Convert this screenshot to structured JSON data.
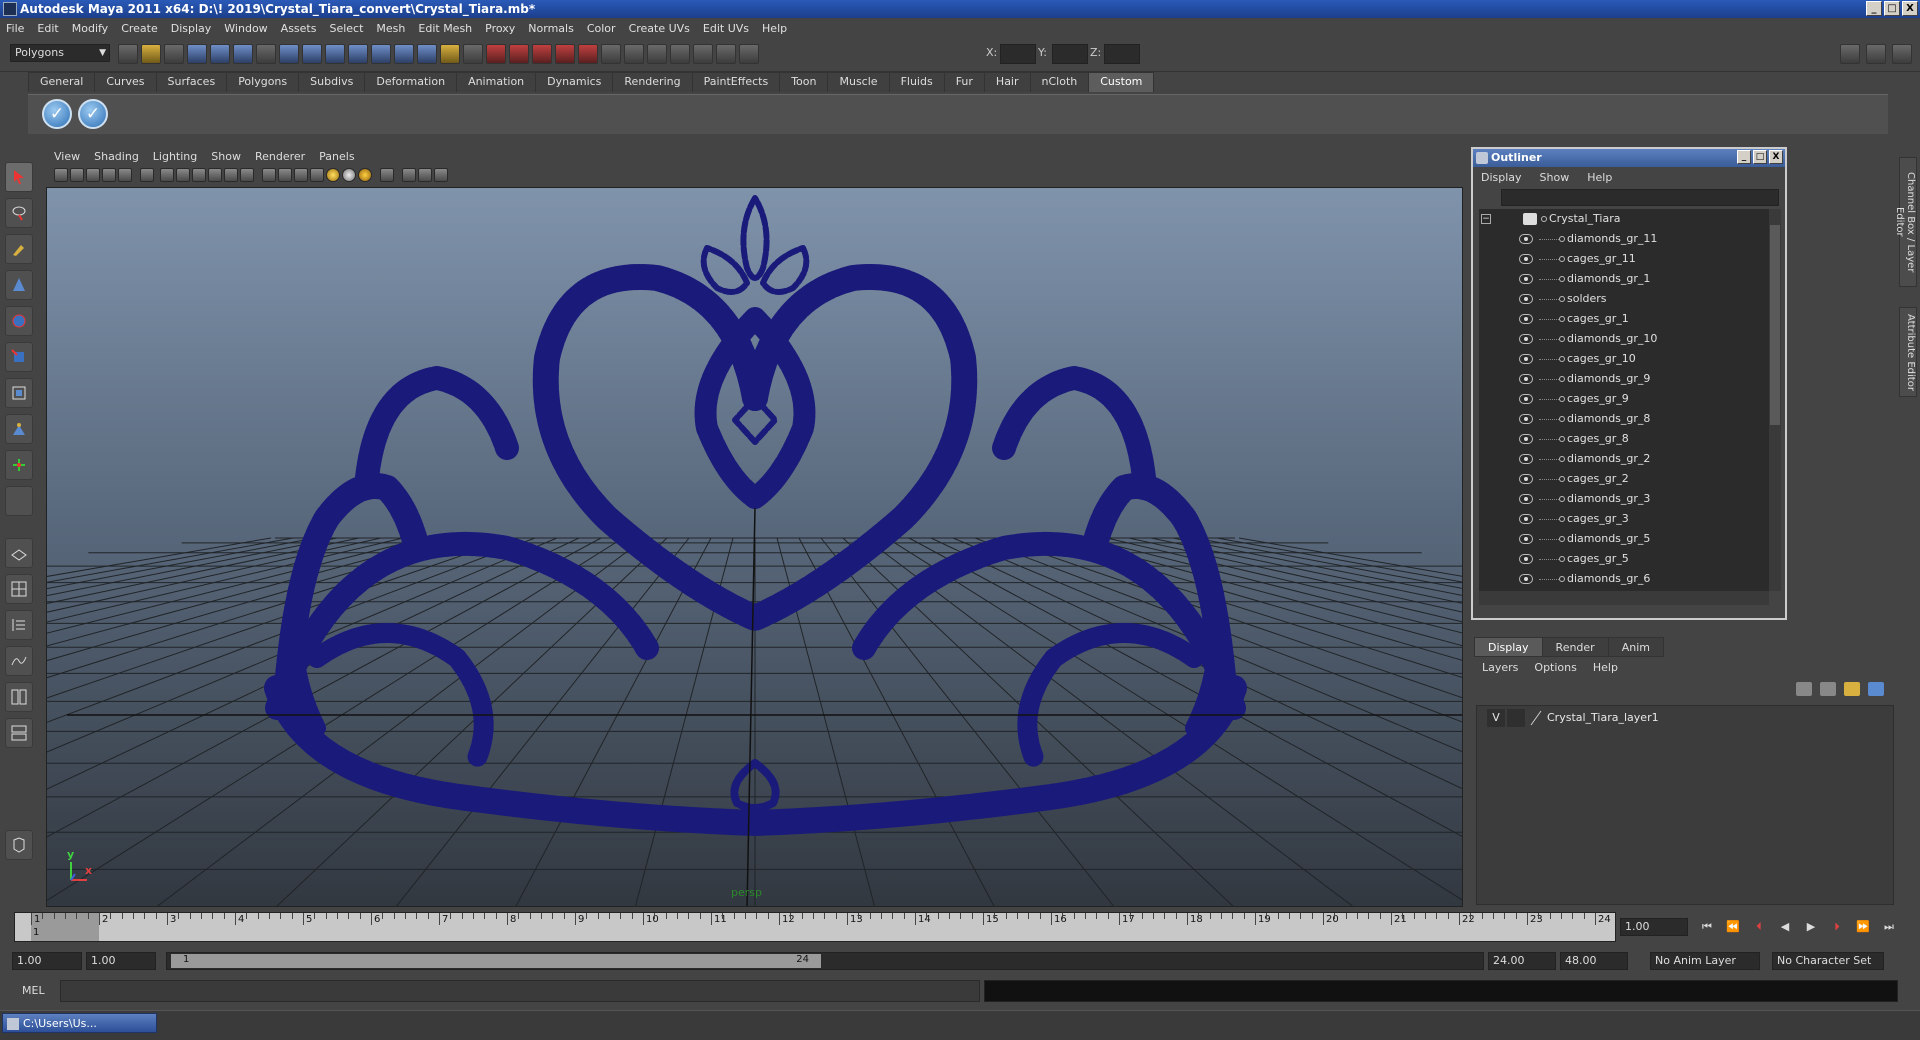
{
  "title_bar": {
    "title": "Autodesk Maya 2011 x64: D:\\! 2019\\Crystal_Tiara_convert\\Crystal_Tiara.mb*",
    "min": "_",
    "max": "□",
    "close": "X"
  },
  "menubar": [
    "File",
    "Edit",
    "Modify",
    "Create",
    "Display",
    "Window",
    "Assets",
    "Select",
    "Mesh",
    "Edit Mesh",
    "Proxy",
    "Normals",
    "Color",
    "Create UVs",
    "Edit UVs",
    "Help"
  ],
  "status_line": {
    "mode": "Polygons",
    "x_label": "X:",
    "y_label": "Y:",
    "z_label": "Z:"
  },
  "shelf": {
    "tabs": [
      "General",
      "Curves",
      "Surfaces",
      "Polygons",
      "Subdivs",
      "Deformation",
      "Animation",
      "Dynamics",
      "Rendering",
      "PaintEffects",
      "Toon",
      "Muscle",
      "Fluids",
      "Fur",
      "Hair",
      "nCloth",
      "Custom"
    ],
    "active_tab": "Custom"
  },
  "viewport": {
    "menu": [
      "View",
      "Shading",
      "Lighting",
      "Show",
      "Renderer",
      "Panels"
    ],
    "camera": "persp",
    "axis_y": "y",
    "axis_x": "x",
    "wire_color": "#1a1a7a"
  },
  "outliner": {
    "title": "Outliner",
    "menu": [
      "Display",
      "Show",
      "Help"
    ],
    "root": "Crystal_Tiara",
    "items": [
      "diamonds_gr_11",
      "cages_gr_11",
      "diamonds_gr_1",
      "solders",
      "cages_gr_1",
      "diamonds_gr_10",
      "cages_gr_10",
      "diamonds_gr_9",
      "cages_gr_9",
      "diamonds_gr_8",
      "cages_gr_8",
      "diamonds_gr_2",
      "cages_gr_2",
      "diamonds_gr_3",
      "cages_gr_3",
      "diamonds_gr_5",
      "cages_gr_5",
      "diamonds_gr_6"
    ]
  },
  "layer_editor": {
    "tabs": [
      "Display",
      "Render",
      "Anim"
    ],
    "active_tab": "Display",
    "menu": [
      "Layers",
      "Options",
      "Help"
    ],
    "layer": {
      "visible": "V",
      "name": "Crystal_Tiara_layer1"
    }
  },
  "side_tabs": [
    "Channel Box / Layer Editor",
    "Attribute Editor"
  ],
  "time_slider": {
    "ticks": [
      "1",
      "2",
      "3",
      "4",
      "5",
      "6",
      "7",
      "8",
      "9",
      "10",
      "11",
      "12",
      "13",
      "14",
      "15",
      "16",
      "17",
      "18",
      "19",
      "20",
      "21",
      "22",
      "23",
      "24"
    ],
    "current_frame_marker": "1",
    "current_time": "1.00"
  },
  "range_slider": {
    "start": "1.00",
    "playback_start": "1.00",
    "range_start": "1",
    "range_end": "24",
    "playback_end": "24.00",
    "end": "48.00",
    "anim_layer": "No Anim Layer",
    "character_set": "No Character Set"
  },
  "command_line": {
    "label": "MEL"
  },
  "taskbar": {
    "item": "C:\\Users\\Us..."
  }
}
